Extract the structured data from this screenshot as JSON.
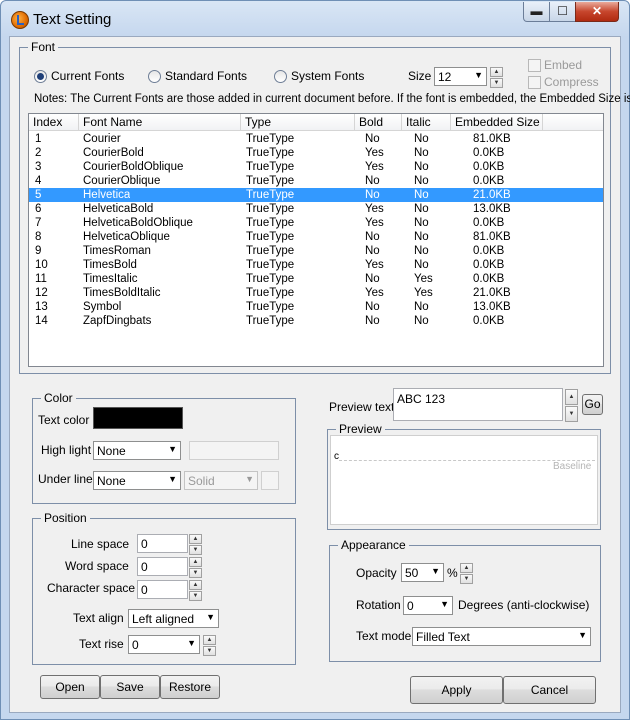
{
  "window": {
    "title": "Text Setting",
    "min_glyph": "▬",
    "max_glyph": "☐",
    "close_glyph": "✕"
  },
  "font": {
    "legend": "Font",
    "radio_current": "Current Fonts",
    "radio_standard": "Standard Fonts",
    "radio_system": "System Fonts",
    "selected_source": "Current Fonts",
    "size_label": "Size",
    "size_value": "12",
    "embed_label": "Embed",
    "compress_label": "Compress",
    "notes": "Notes: The Current Fonts are those added in current document before. If the font is embedded, the Embedded Size is",
    "columns": [
      "Index",
      "Font Name",
      "Type",
      "Bold",
      "Italic",
      "Embedded Size"
    ],
    "rows": [
      [
        "1",
        "Courier",
        "TrueType",
        "No",
        "No",
        "81.0KB"
      ],
      [
        "2",
        "CourierBold",
        "TrueType",
        "Yes",
        "No",
        "0.0KB"
      ],
      [
        "3",
        "CourierBoldOblique",
        "TrueType",
        "Yes",
        "No",
        "0.0KB"
      ],
      [
        "4",
        "CourierOblique",
        "TrueType",
        "No",
        "No",
        "0.0KB"
      ],
      [
        "5",
        "Helvetica",
        "TrueType",
        "No",
        "No",
        "21.0KB"
      ],
      [
        "6",
        "HelveticaBold",
        "TrueType",
        "Yes",
        "No",
        "13.0KB"
      ],
      [
        "7",
        "HelveticaBoldOblique",
        "TrueType",
        "Yes",
        "No",
        "0.0KB"
      ],
      [
        "8",
        "HelveticaOblique",
        "TrueType",
        "No",
        "No",
        "81.0KB"
      ],
      [
        "9",
        "TimesRoman",
        "TrueType",
        "No",
        "No",
        "0.0KB"
      ],
      [
        "10",
        "TimesBold",
        "TrueType",
        "Yes",
        "No",
        "0.0KB"
      ],
      [
        "11",
        "TimesItalic",
        "TrueType",
        "No",
        "Yes",
        "0.0KB"
      ],
      [
        "12",
        "TimesBoldItalic",
        "TrueType",
        "Yes",
        "Yes",
        "21.0KB"
      ],
      [
        "13",
        "Symbol",
        "TrueType",
        "No",
        "No",
        "13.0KB"
      ],
      [
        "14",
        "ZapfDingbats",
        "TrueType",
        "No",
        "No",
        "0.0KB"
      ]
    ],
    "selected_row": "5"
  },
  "color": {
    "legend": "Color",
    "text_color_label": "Text color",
    "text_color_value": "#000000",
    "highlight_label": "High light",
    "highlight_value": "None",
    "underline_label": "Under line",
    "underline_value": "None",
    "underline_style": "Solid"
  },
  "position": {
    "legend": "Position",
    "line_space_label": "Line space",
    "line_space_value": "0",
    "word_space_label": "Word space",
    "word_space_value": "0",
    "char_space_label": "Character space",
    "char_space_value": "0",
    "text_align_label": "Text align",
    "text_align_value": "Left aligned",
    "text_rise_label": "Text rise",
    "text_rise_value": "0"
  },
  "preview": {
    "label": "Preview text",
    "text": "ABC 123",
    "go_label": "Go",
    "legend": "Preview",
    "sample_char": "c",
    "baseline_label": "Baseline"
  },
  "appearance": {
    "legend": "Appearance",
    "opacity_label": "Opacity",
    "opacity_value": "50",
    "opacity_unit": "%",
    "rotation_label": "Rotation",
    "rotation_value": "0",
    "rotation_unit": "Degrees (anti-clockwise)",
    "text_mode_label": "Text mode",
    "text_mode_value": "Filled Text"
  },
  "buttons": {
    "open": "Open",
    "save": "Save",
    "restore": "Restore",
    "apply": "Apply",
    "cancel": "Cancel"
  }
}
